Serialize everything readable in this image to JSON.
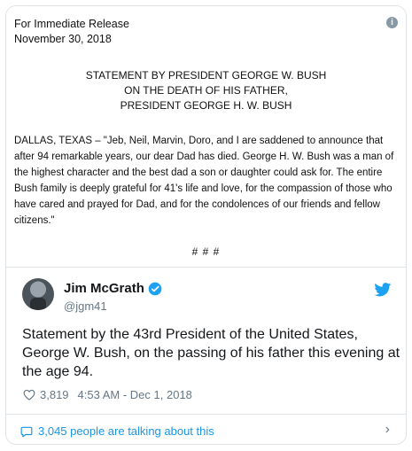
{
  "release": {
    "line1": "For Immediate Release",
    "line2": "November 30, 2018",
    "heading1": "STATEMENT BY PRESIDENT GEORGE W. BUSH",
    "heading2": "ON THE DEATH OF HIS FATHER,",
    "heading3": "PRESIDENT GEORGE H. W. BUSH",
    "body": "DALLAS, TEXAS – \"Jeb, Neil, Marvin, Doro, and I are saddened to announce that after 94 remarkable years, our dear Dad has died. George H. W. Bush was a man of the highest character and the best dad a son or daughter could ask for. The entire Bush family is deeply grateful for 41's life and love, for the compassion of those who have cared and prayed for Dad, and for the condolences of our friends and fellow citizens.\"",
    "end_marks": "#    #    #"
  },
  "tweet": {
    "author_name": "Jim McGrath",
    "handle": "@jgm41",
    "text": "Statement by the 43rd President of the United States, George W. Bush, on the passing of his father this evening at the age 94.",
    "likes": "3,819",
    "timestamp": "4:53 AM - Dec 1, 2018",
    "talking": "3,045 people are talking about this"
  },
  "colors": {
    "accent": "#1b95e0",
    "muted": "#657786",
    "border": "#dfe3e7"
  },
  "icons": [
    "info-icon",
    "verified-badge-icon",
    "twitter-bird-icon",
    "heart-icon",
    "speech-bubble-icon",
    "chevron-right-icon"
  ]
}
